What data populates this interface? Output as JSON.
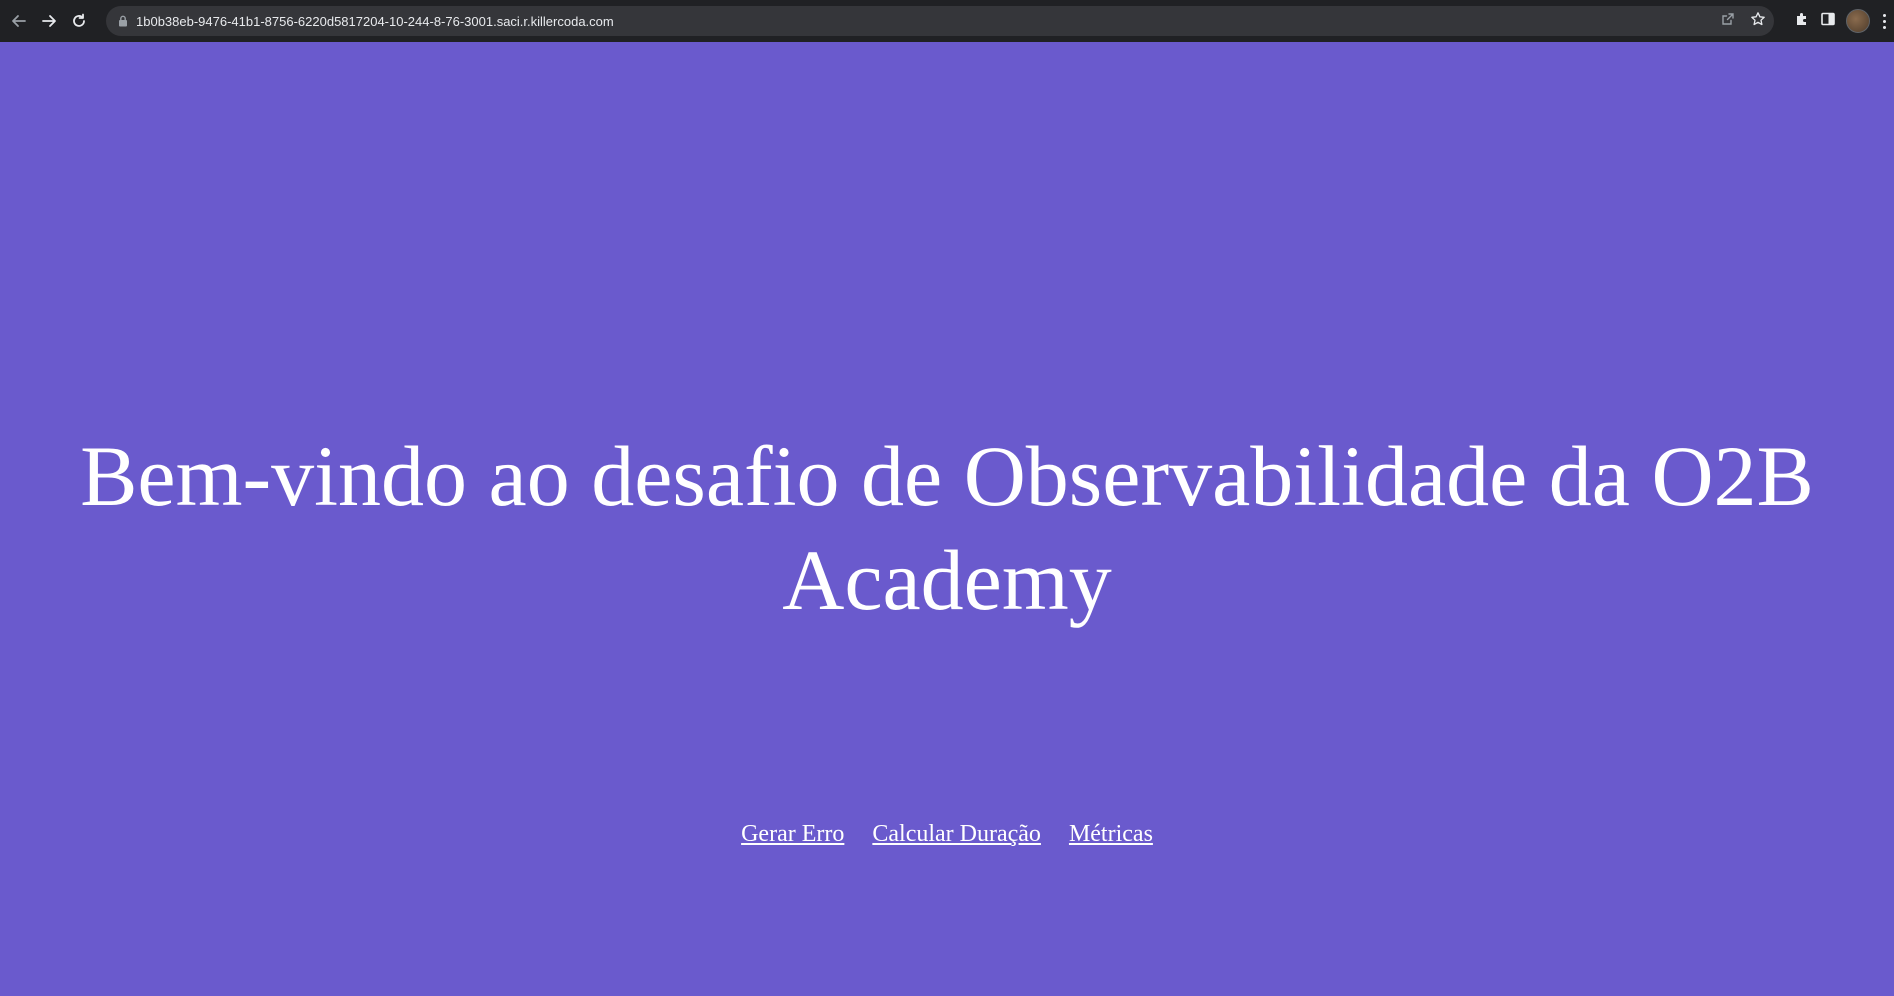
{
  "browser": {
    "url": "1b0b38eb-9476-41b1-8756-6220d5817204-10-244-8-76-3001.saci.r.killercoda.com",
    "nav_icons": [
      "back-arrow-icon",
      "forward-arrow-icon",
      "reload-icon"
    ],
    "omnibox_icons": [
      "lock-icon",
      "share-icon",
      "star-icon"
    ],
    "toolbar_icons": [
      "puzzle-extensions-icon",
      "side-panel-icon",
      "profile-avatar-icon",
      "more-menu-icon"
    ]
  },
  "page": {
    "background": "#6a5acd",
    "heading": "Bem-vindo ao desafio de Observabilidade da O2B Academy",
    "links": [
      "Gerar Erro",
      "Calcular Duração",
      "Métricas"
    ]
  }
}
